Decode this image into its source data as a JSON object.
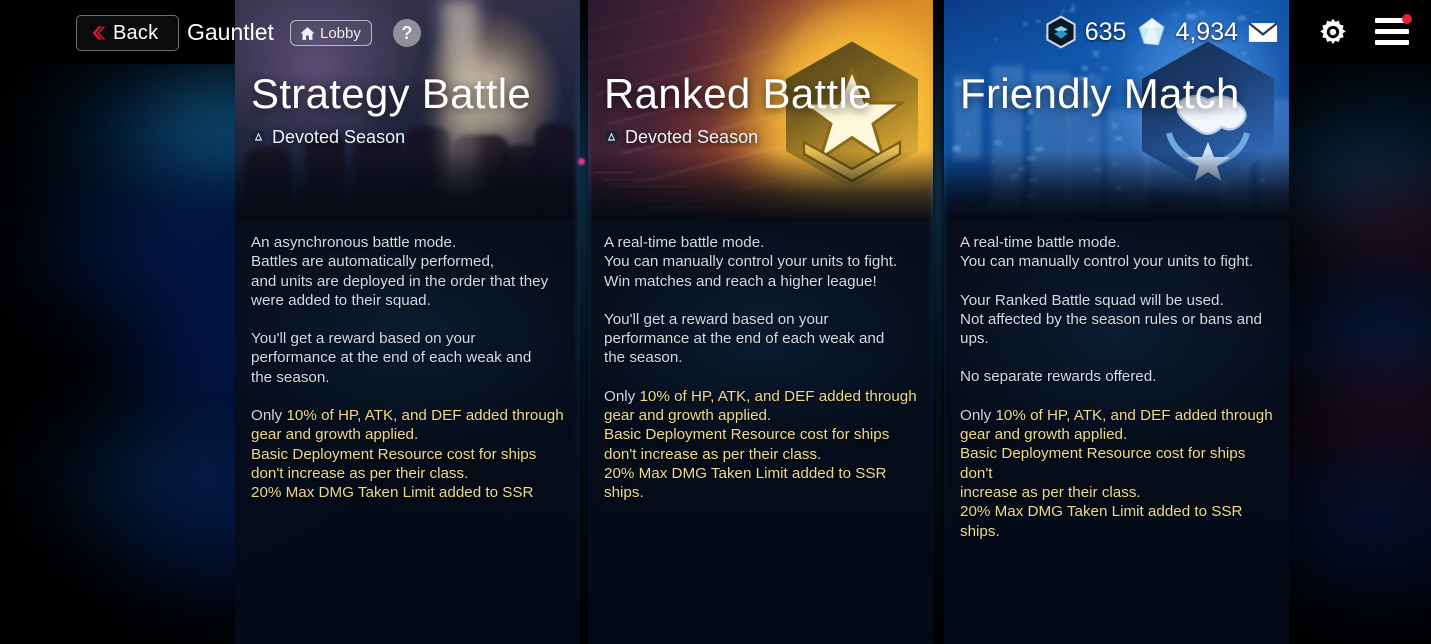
{
  "header": {
    "back_label": "Back",
    "back_icon": "chevron-left-icon",
    "page_title": "Gauntlet",
    "lobby_label": "Lobby",
    "lobby_icon": "home-icon",
    "help_label": "?",
    "help_icon": "question-mark-icon"
  },
  "hud": {
    "currency_icon": "hexagon-token-icon",
    "currency_value": "635",
    "gem_icon": "diamond-gem-icon",
    "gem_value": "4,934",
    "mail_icon": "envelope-icon",
    "settings_icon": "gear-icon",
    "menu_icon": "hamburger-menu-icon",
    "menu_has_notification": true
  },
  "colors": {
    "rules_text": "#efd98b",
    "body_text": "#d5dbe6",
    "accent_red": "#e8203a",
    "notification_dot": "#e8203a",
    "gold_badge": "#f0c54d",
    "blue_badge": "#3d7fd0"
  },
  "panels": [
    {
      "id": "strategy-battle",
      "title": "Strategy Battle",
      "subtitle": "Devoted Season",
      "subtitle_icon": "season-emblem-icon",
      "badge_icon": "",
      "paragraphs": [
        [
          "An asynchronous battle mode.",
          "Battles are automatically performed,",
          "and units are deployed in the order that they",
          "were added to their squad."
        ],
        [
          "You'll get a reward based on your",
          "performance at the end of each weak and",
          "the season."
        ]
      ],
      "rules_lead": "Only ",
      "rules": [
        "10% of HP, ATK, and DEF added through",
        "gear and growth applied.",
        "Basic Deployment Resource cost for ships",
        "don't increase as per their class.",
        "20% Max DMG Taken Limit added to SSR"
      ]
    },
    {
      "id": "ranked-battle",
      "title": "Ranked Battle",
      "subtitle": "Devoted Season",
      "subtitle_icon": "season-emblem-icon",
      "badge_icon": "gold-star-hexagon-badge-icon",
      "paragraphs": [
        [
          "A real-time battle mode.",
          "You can manually control your units to fight.",
          "Win matches and reach a higher league!"
        ],
        [
          "You'll get a reward based on your",
          "performance at the end of each weak and",
          "the season."
        ]
      ],
      "rules_lead": "Only ",
      "rules": [
        "10% of HP, ATK, and DEF added through",
        "gear and growth applied.",
        "Basic Deployment Resource cost for ships",
        "don't increase as per their class.",
        "20% Max DMG Taken Limit added to SSR",
        "ships."
      ]
    },
    {
      "id": "friendly-match",
      "title": "Friendly Match",
      "subtitle": "",
      "subtitle_icon": "",
      "badge_icon": "blue-handshake-laurel-hexagon-badge-icon",
      "paragraphs": [
        [
          "A real-time battle mode.",
          "You can manually control your units to fight."
        ],
        [
          "Your Ranked Battle squad will be used.",
          "Not affected by the season rules or bans and",
          "ups."
        ],
        [
          "No separate rewards offered."
        ]
      ],
      "rules_lead": "Only ",
      "rules": [
        "10% of HP, ATK, and DEF added through",
        "gear and growth applied.",
        "Basic Deployment Resource cost for ships don't",
        "increase as per their class.",
        "20% Max DMG Taken Limit added to SSR ships."
      ]
    }
  ]
}
